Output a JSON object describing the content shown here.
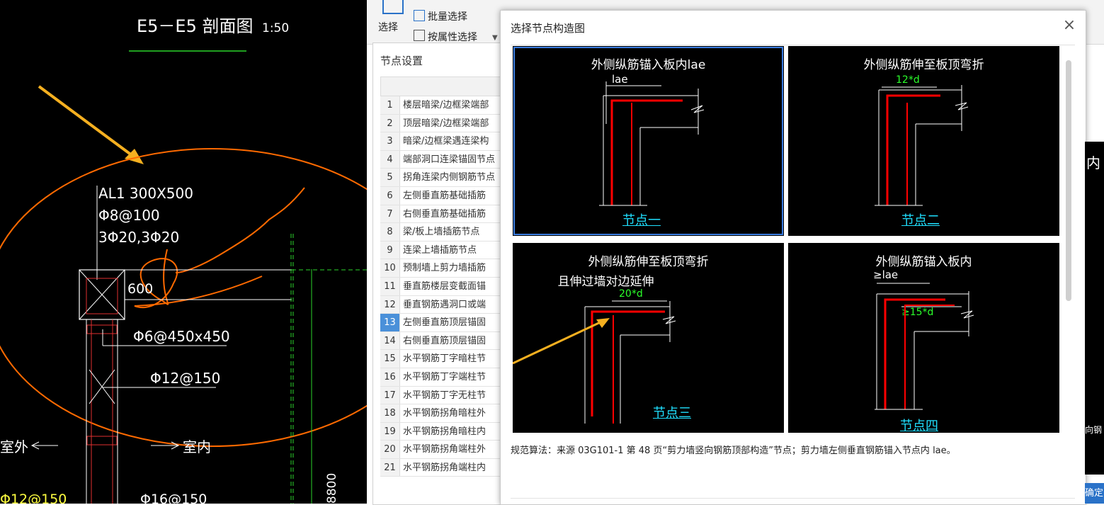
{
  "cad": {
    "section_title": "E5－E5 剖面图",
    "scale": "1:50",
    "beam_label": "AL1 300X500",
    "stirrup": "Φ8@100",
    "bars": "3Φ20,3Φ20",
    "dim_600": "600",
    "tie": "Φ6@450x450",
    "vert_bar": "Φ12@150",
    "outside": "室外",
    "inside": "室内",
    "bottom_left": "Φ12@150",
    "bottom_mid": "Φ16@150",
    "dim_8800": "8800"
  },
  "ribbon": {
    "select_label": "选择",
    "batch_select": "批量选择",
    "attr_select": "按属性选择"
  },
  "node_settings": {
    "title": "节点设置",
    "rows": [
      {
        "num": "1",
        "name": "楼层暗梁/边框梁端部"
      },
      {
        "num": "2",
        "name": "顶层暗梁/边框梁端部"
      },
      {
        "num": "3",
        "name": "暗梁/边框梁遇连梁构"
      },
      {
        "num": "4",
        "name": "端部洞口连梁锚固节点"
      },
      {
        "num": "5",
        "name": "拐角连梁内侧钢筋节点"
      },
      {
        "num": "6",
        "name": "左侧垂直筋基础插筋"
      },
      {
        "num": "7",
        "name": "右侧垂直筋基础插筋"
      },
      {
        "num": "8",
        "name": "梁/板上墙插筋节点"
      },
      {
        "num": "9",
        "name": "连梁上墙插筋节点"
      },
      {
        "num": "10",
        "name": "预制墙上剪力墙插筋"
      },
      {
        "num": "11",
        "name": "垂直筋楼层变截面锚"
      },
      {
        "num": "12",
        "name": "垂直钢筋遇洞口或端"
      },
      {
        "num": "13",
        "name": "左侧垂直筋顶层锚固"
      },
      {
        "num": "14",
        "name": "右侧垂直筋顶层锚固"
      },
      {
        "num": "15",
        "name": "水平钢筋丁字暗柱节"
      },
      {
        "num": "16",
        "name": "水平钢筋丁字端柱节"
      },
      {
        "num": "17",
        "name": "水平钢筋丁字无柱节"
      },
      {
        "num": "18",
        "name": "水平钢筋拐角暗柱外"
      },
      {
        "num": "19",
        "name": "水平钢筋拐角暗柱内"
      },
      {
        "num": "20",
        "name": "水平钢筋拐角端柱外"
      },
      {
        "num": "21",
        "name": "水平钢筋拐角端柱内"
      }
    ],
    "selected_num": "13"
  },
  "dialog": {
    "title": "选择节点构造图",
    "close": "×",
    "tiles": [
      {
        "title": "外侧纵筋锚入板内lae",
        "dim": "lae",
        "link": "节点一"
      },
      {
        "title": "外侧纵筋伸至板顶弯折",
        "dim": "12*d",
        "link": "节点二"
      },
      {
        "title": "外侧纵筋伸至板顶弯折",
        "title2": "且伸过墙对边延伸",
        "dim": "20*d",
        "link": "节点三"
      },
      {
        "title": "外侧纵筋锚入板内",
        "dim": "≥lae",
        "dim2": "≥15*d",
        "link": "节点四"
      }
    ],
    "description": "规范算法：来源 03G101-1 第 48 页“剪力墙竖向钢筋顶部构造”节点；剪力墙左侧垂直钢筋锚入节点内 lae。"
  },
  "right_strip": {
    "glyph_top": "内",
    "glyph_mid": "向钢",
    "ok_label": "确定"
  },
  "colors": {
    "cad_bg": "#000000",
    "rebar": "#ff0000",
    "highlight": "#ff6a00",
    "arrow": "#f5b020",
    "link": "#1fe0ff",
    "dim_green": "#2bff2b",
    "selection": "#3b7de0"
  }
}
